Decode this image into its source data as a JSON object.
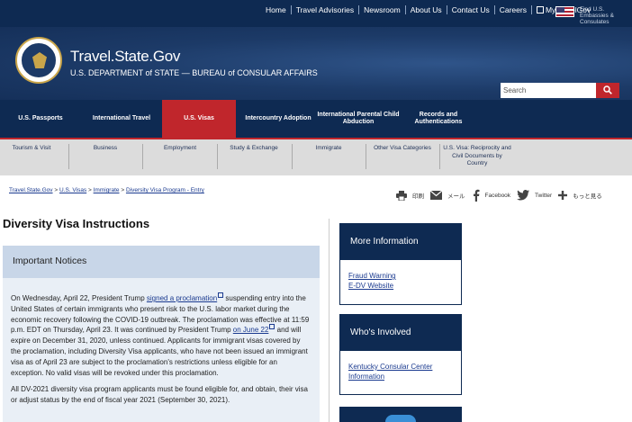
{
  "top_links": [
    "Home",
    "Travel Advisories",
    "Newsroom",
    "About Us",
    "Contact Us",
    "Careers",
    "MyTravelGov"
  ],
  "embassy_link": "Find U.S. Embassies & Consulates",
  "site": {
    "title": "Travel.State.Gov",
    "subtitle": "U.S. DEPARTMENT of STATE — BUREAU of CONSULAR AFFAIRS"
  },
  "search": {
    "placeholder": "Search"
  },
  "main_nav": [
    "U.S. Passports",
    "International Travel",
    "U.S. Visas",
    "Intercountry Adoption",
    "International Parental Child Abduction",
    "Records and Authentications"
  ],
  "main_nav_active": "U.S. Visas",
  "sub_nav": [
    "Tourism & Visit",
    "Business",
    "Employment",
    "Study & Exchange",
    "Immigrate",
    "Other Visa Categories",
    "U.S. Visa: Reciprocity and Civil Documents by Country"
  ],
  "breadcrumb": [
    "Travel.State.Gov",
    "U.S. Visas",
    "Immigrate",
    "Diversity Visa Program - Entry"
  ],
  "share": [
    "印刷",
    "メール",
    "Facebook",
    "Twitter",
    "もっと見る"
  ],
  "page_title": "Diversity Visa Instructions",
  "notice": {
    "heading": "Important Notices",
    "p1_a": "On Wednesday, April 22, President Trump ",
    "p1_link1": "signed a proclamation",
    "p1_b": " suspending entry into the United States of certain immigrants who present risk to the U.S. labor market during the economic recovery following the COVID-19 outbreak. The proclamation was effective at 11:59 p.m. EDT on Thursday, April 23. It was continued by President Trump ",
    "p1_link2": "on June 22",
    "p1_c": " and will expire on December 31, 2020, unless continued. Applicants for immigrant visas covered by the proclamation, including Diversity Visa applicants, who have not been issued an immigrant visa as of April 23 are subject to the proclamation's restrictions unless eligible for an exception. No valid visas will be revoked under this proclamation.",
    "p2": "All DV-2021 diversity visa program applicants must be found eligible for, and obtain, their visa or adjust status by the end of fiscal year 2021 (September 30, 2021)."
  },
  "sidebar": {
    "more_info": {
      "title": "More Information",
      "links": [
        "Fraud Warning",
        "E-DV Website"
      ]
    },
    "whos_involved": {
      "title": "Who's Involved",
      "links": [
        "Kentucky Consular Center Information"
      ]
    }
  },
  "colors": {
    "navy": "#0e2a52",
    "accent_red": "#c0262c",
    "link": "#1a3a8f",
    "notice_bg": "#e9eff6"
  },
  "icons": [
    "print-icon",
    "mail-icon",
    "facebook-icon",
    "twitter-icon",
    "plus-icon",
    "search-icon",
    "globe-icon"
  ]
}
